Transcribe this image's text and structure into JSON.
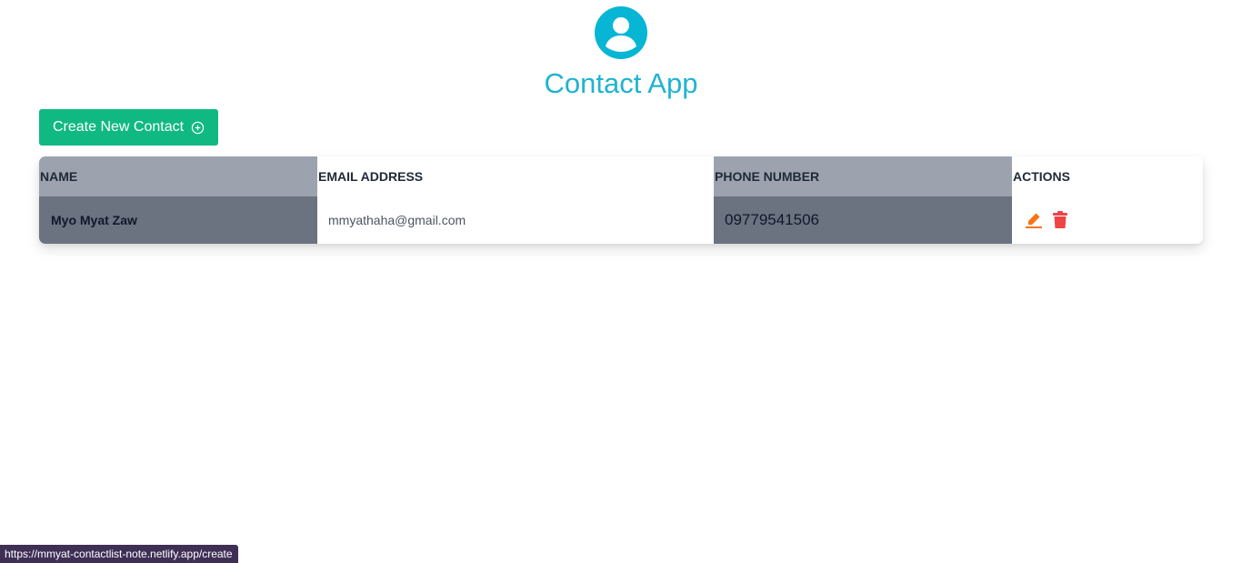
{
  "header": {
    "avatar_icon": "user-circle-icon",
    "title": "Contact App",
    "accent_color": "#1fb3d2"
  },
  "toolbar": {
    "create_label": "Create New Contact",
    "create_icon": "plus-circle-icon",
    "create_color": "#10b981"
  },
  "table": {
    "columns": [
      "NAME",
      "EMAIL ADDRESS",
      "PHONE NUMBER",
      "ACTIONS"
    ],
    "rows": [
      {
        "name": "Myo Myat Zaw",
        "email": "mmyathaha@gmail.com",
        "phone": "09779541506",
        "actions": [
          "edit-icon",
          "trash-icon"
        ]
      }
    ]
  },
  "status_bar": {
    "url": "https://mmyat-contactlist-note.netlify.app/create"
  }
}
